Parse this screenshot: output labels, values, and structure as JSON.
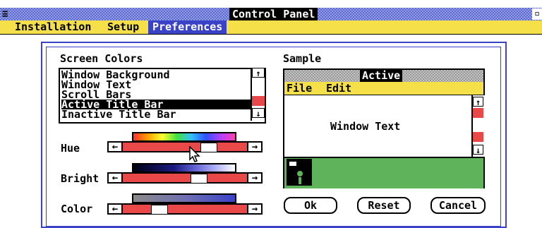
{
  "window": {
    "title": "Control Panel",
    "system_menu_icon": "≡",
    "maximize_icon": "▫"
  },
  "menubar": {
    "items": [
      "Installation",
      "Setup",
      "Preferences"
    ],
    "selected": "Preferences"
  },
  "screen_colors": {
    "label": "Screen Colors",
    "items": [
      "Window Background",
      "Window Text",
      "Scroll Bars",
      "Active Title Bar",
      "Inactive Title Bar"
    ],
    "selected_index": 3
  },
  "sliders": {
    "hue": {
      "label": "Hue"
    },
    "bright": {
      "label": "Bright"
    },
    "color": {
      "label": "Color"
    }
  },
  "arrows": {
    "left": "←",
    "right": "→",
    "up": "↑",
    "down": "↓"
  },
  "sample": {
    "label": "Sample",
    "title": "Active",
    "menu": [
      "File",
      "Edit"
    ],
    "client_text": "Window Text"
  },
  "buttons": {
    "ok": "Ok",
    "reset": "Reset",
    "cancel": "Cancel"
  },
  "colors": {
    "accent_blue": "#3a43c8",
    "menu_yellow": "#f5e04a",
    "scroll_red": "#e84848",
    "desktop_green": "#5fb35a"
  }
}
